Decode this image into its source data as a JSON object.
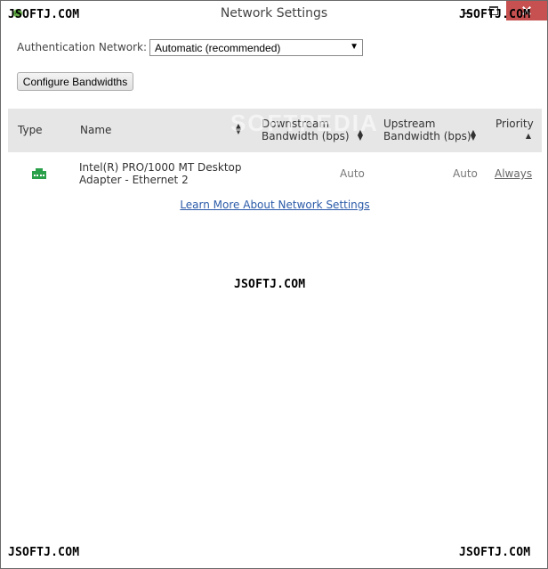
{
  "window": {
    "title": "Network Settings"
  },
  "auth": {
    "label": "Authentication Network:",
    "selected": "Automatic (recommended)"
  },
  "toolbar": {
    "configure_label": "Configure Bandwidths"
  },
  "table": {
    "headers": {
      "type": "Type",
      "name": "Name",
      "downstream_line1": "Downstream",
      "downstream_line2": "Bandwidth (bps)",
      "upstream_line1": "Upstream",
      "upstream_line2": "Bandwidth (bps)",
      "priority": "Priority"
    },
    "rows": [
      {
        "icon": "network-adapter-icon",
        "name_line1": "Intel(R) PRO/1000 MT Desktop",
        "name_line2": "Adapter - Ethernet 2",
        "downstream": "Auto",
        "upstream": "Auto",
        "priority": "Always"
      }
    ]
  },
  "links": {
    "learn_more": "Learn More About Network Settings"
  },
  "watermark": {
    "text": "JSOFTJ.COM",
    "faint": "SOFTPEDIA"
  },
  "colors": {
    "adapter_icon": "#2aa04a",
    "link": "#2a5aa8",
    "header_bg": "#e6e6e6",
    "close_button": "#c75050"
  }
}
